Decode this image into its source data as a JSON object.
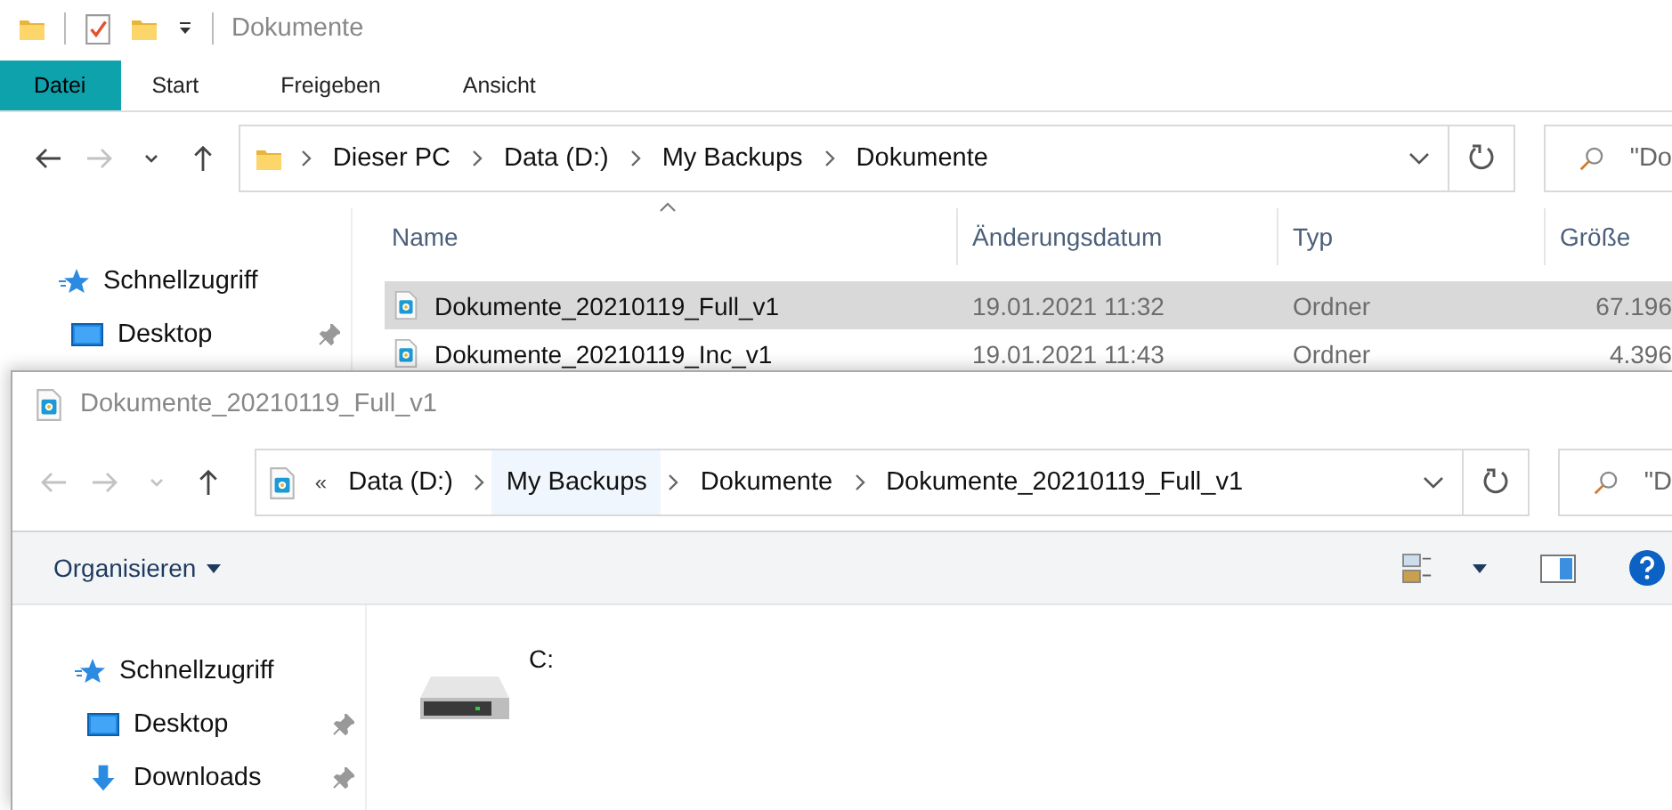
{
  "back_window": {
    "title": "Dokumente",
    "ribbon_tabs": [
      {
        "label": "Datei",
        "selected": true
      },
      {
        "label": "Start",
        "selected": false
      },
      {
        "label": "Freigeben",
        "selected": false
      },
      {
        "label": "Ansicht",
        "selected": false
      }
    ],
    "nav_buttons": [
      {
        "kind": "back",
        "disabled": false
      },
      {
        "kind": "forward",
        "disabled": true
      },
      {
        "kind": "recent",
        "disabled": false
      },
      {
        "kind": "up",
        "disabled": false
      }
    ],
    "address_crumbs": [
      {
        "label": "Dieser PC",
        "highlighted": false
      },
      {
        "label": "Data (D:)",
        "highlighted": false
      },
      {
        "label": "My Backups",
        "highlighted": false
      },
      {
        "label": "Dokumente",
        "highlighted": false
      }
    ],
    "search": {
      "value": "\"Do"
    },
    "sidebar": [
      {
        "label": "Schnellzugriff",
        "kind": "star",
        "pinned": false
      },
      {
        "label": "Desktop",
        "kind": "desktop",
        "pinned": true
      }
    ],
    "columns": [
      "Name",
      "Änderungsdatum",
      "Typ",
      "Größe"
    ],
    "rows": [
      {
        "name": "Dokumente_20210119_Full_v1",
        "date": "19.01.2021 11:32",
        "type": "Ordner",
        "size": "67.196",
        "selected": true
      },
      {
        "name": "Dokumente_20210119_Inc_v1",
        "date": "19.01.2021 11:43",
        "type": "Ordner",
        "size": "4.396",
        "selected": false
      }
    ]
  },
  "front_window": {
    "title": "Dokumente_20210119_Full_v1",
    "nav_buttons": [
      {
        "kind": "back",
        "disabled": true
      },
      {
        "kind": "forward",
        "disabled": true
      },
      {
        "kind": "recent",
        "disabled": true
      },
      {
        "kind": "up",
        "disabled": false
      }
    ],
    "crumb_overflow": "«",
    "address_crumbs": [
      {
        "label": "Data (D:)",
        "highlighted": false
      },
      {
        "label": "My Backups",
        "highlighted": true
      },
      {
        "label": "Dokumente",
        "highlighted": false
      },
      {
        "label": "Dokumente_20210119_Full_v1",
        "highlighted": false
      }
    ],
    "search": {
      "value": "\"D"
    },
    "command": "Organisieren",
    "sidebar": [
      {
        "label": "Schnellzugriff",
        "kind": "star",
        "pinned": false
      },
      {
        "label": "Desktop",
        "kind": "desktop",
        "pinned": true
      },
      {
        "label": "Downloads",
        "kind": "downloads",
        "pinned": true
      }
    ],
    "items": [
      {
        "label": "C:",
        "kind": "drive"
      }
    ]
  }
}
